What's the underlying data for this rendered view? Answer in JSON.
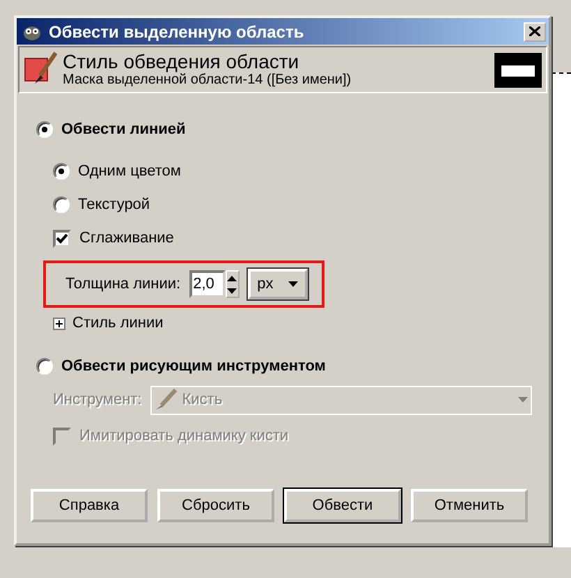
{
  "window": {
    "title": "Обвести выделенную область"
  },
  "header": {
    "title": "Стиль обведения области",
    "subtitle": "Маска выделенной области-14 ([Без имени])"
  },
  "stroke_line": {
    "label": "Обвести линией",
    "selected": true,
    "fill_options": [
      {
        "label": "Одним цветом",
        "selected": true
      },
      {
        "label": "Текстурой",
        "selected": false
      }
    ],
    "antialiasing": {
      "label": "Сглаживание",
      "checked": true
    },
    "line_width": {
      "label": "Толщина линии:",
      "value": "2,0",
      "unit": "px",
      "highlighted": true
    },
    "line_style": {
      "label": "Стиль линии",
      "expanded": false
    }
  },
  "stroke_tool": {
    "label": "Обвести рисующим инструментом",
    "selected": false,
    "tool": {
      "label": "Инструмент:",
      "value": "Кисть",
      "disabled": true
    },
    "emulate_dynamics": {
      "label": "Имитировать динамику кисти",
      "checked": false,
      "disabled": true
    }
  },
  "buttons": [
    {
      "label": "Справка",
      "default": false
    },
    {
      "label": "Сбросить",
      "default": false
    },
    {
      "label": "Обвести",
      "default": true
    },
    {
      "label": "Отменить",
      "default": false
    }
  ]
}
